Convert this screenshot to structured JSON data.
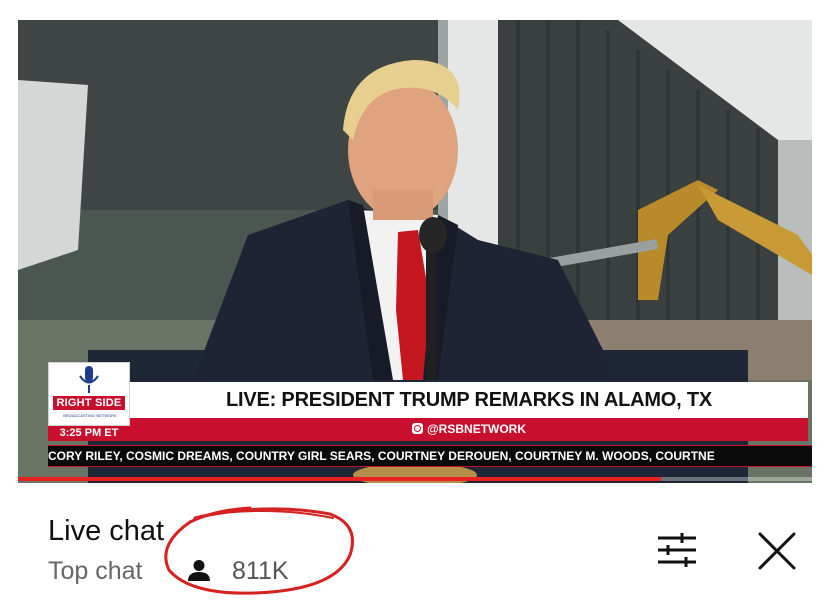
{
  "video": {
    "headline": "LIVE: PRESIDENT TRUMP REMARKS IN ALAMO, TX",
    "handle": "@RSBNETWORK",
    "logo_text": "RIGHT SIDE",
    "logo_subtext": "BROADCASTING NETWORK",
    "time": "3:25 PM ET",
    "ticker": "CORY RILEY, COSMIC DREAMS, COUNTRY GIRL SEARS, COURTNEY DEROUEN, COURTNEY M. WOODS, COURTNE",
    "progress_fraction": 0.81,
    "colors": {
      "brand_red": "#c8102e",
      "progress_red": "#e8201f"
    }
  },
  "chat": {
    "title": "Live chat",
    "mode": "Top chat",
    "viewer_count": "811K",
    "icons": [
      "person-icon",
      "tune-filter-icon",
      "close-icon"
    ],
    "annotation_color": "#d62121"
  }
}
